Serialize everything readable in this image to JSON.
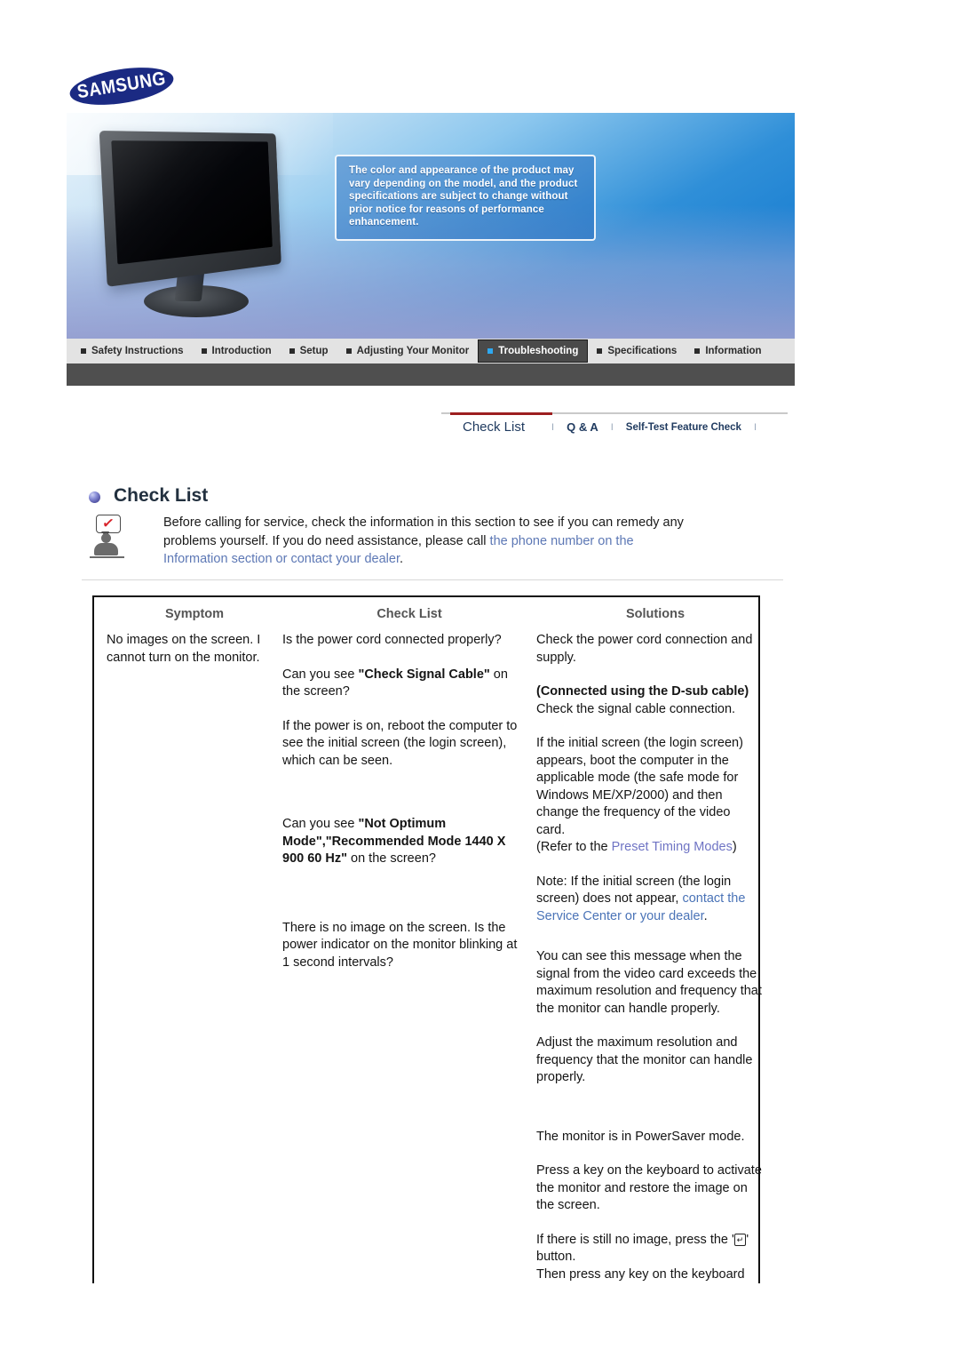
{
  "brand": {
    "logo_text": "SAMSUNG"
  },
  "banner": {
    "note": "The color and appearance of the product may vary depending on the model, and the product specifications are subject to change without prior notice for reasons of performance enhancement."
  },
  "mainnav": {
    "items": [
      {
        "label": "Safety Instructions",
        "active": false
      },
      {
        "label": "Introduction",
        "active": false
      },
      {
        "label": "Setup",
        "active": false
      },
      {
        "label": "Adjusting Your Monitor",
        "active": false
      },
      {
        "label": "Troubleshooting",
        "active": true
      },
      {
        "label": "Specifications",
        "active": false
      },
      {
        "label": "Information",
        "active": false
      }
    ]
  },
  "subnav": {
    "items": [
      {
        "label": "Check List",
        "active": true
      },
      {
        "label": "Q & A",
        "active": false
      },
      {
        "label": "Self-Test Feature Check",
        "active": false
      }
    ],
    "separator": "I"
  },
  "section": {
    "title": "Check List",
    "bullet_icon": "sphere-bullet-icon",
    "intro": {
      "line1": "Before calling for service, check the information in this section to see if you can remedy any",
      "line2a": "problems yourself. If you do need assistance, please call ",
      "line2_link": "the phone number on the",
      "line3_link": "Information section or contact your dealer",
      "line3_end": "."
    }
  },
  "table": {
    "headers": [
      "Symptom",
      "Check List",
      "Solutions"
    ],
    "rows": [
      {
        "symptom": [
          "No images on the screen. I cannot turn on the monitor."
        ],
        "checklist": [
          {
            "text": "Is the power cord connected properly?"
          },
          {
            "pre": "Can you see ",
            "bold": "\"Check Signal Cable\"",
            "post": " on the screen?"
          },
          {
            "text": "If the power is on, reboot the computer to see the initial screen (the login screen), which can be seen."
          },
          {
            "pre": "Can you see ",
            "bold": "\"Not Optimum Mode\",\"Recommended Mode 1440 X 900 60 Hz\"",
            "post": " on the screen?"
          },
          {
            "text": "There is no image on the screen. Is the power indicator on the monitor blinking at 1 second intervals?"
          }
        ],
        "solutions": [
          {
            "text": "Check the power cord connection and supply."
          },
          {
            "bold": "(Connected using the D-sub cable)",
            "post_line": "Check the signal cable connection."
          },
          {
            "text": "If the initial screen (the login screen) appears, boot the computer in the applicable mode (the safe mode for Windows ME/XP/2000) and then change the frequency of the video card."
          },
          {
            "pre": "(Refer to the ",
            "link": "Preset Timing Modes",
            "post": ")"
          },
          {
            "pre2": "Note: If the initial screen (the login screen) does not appear, ",
            "link2": "contact the Service Center or your dealer",
            "post2": "."
          },
          {
            "text": "You can see this message when the signal from the video card exceeds the maximum resolution and frequency that the monitor can handle properly."
          },
          {
            "text": "Adjust the maximum resolution and frequency that the monitor can handle properly."
          },
          {
            "text": "The monitor is in PowerSaver mode."
          },
          {
            "text": "Press a key on the keyboard to activate the monitor and restore the image on the screen."
          },
          {
            "pre3": "If there is still no image, press the '",
            "glyph": "↵",
            "post3": "' button."
          },
          {
            "text4": "Then press any key on the keyboard"
          }
        ]
      }
    ]
  },
  "colors": {
    "accent_blue": "#2ea8f0",
    "link_blue": "#5d78b5",
    "active_underline": "#9d1f20",
    "brand_navy": "#1b2a83",
    "nav_bg": "#e3e3e3",
    "nav_strip": "#4f4f4f"
  }
}
